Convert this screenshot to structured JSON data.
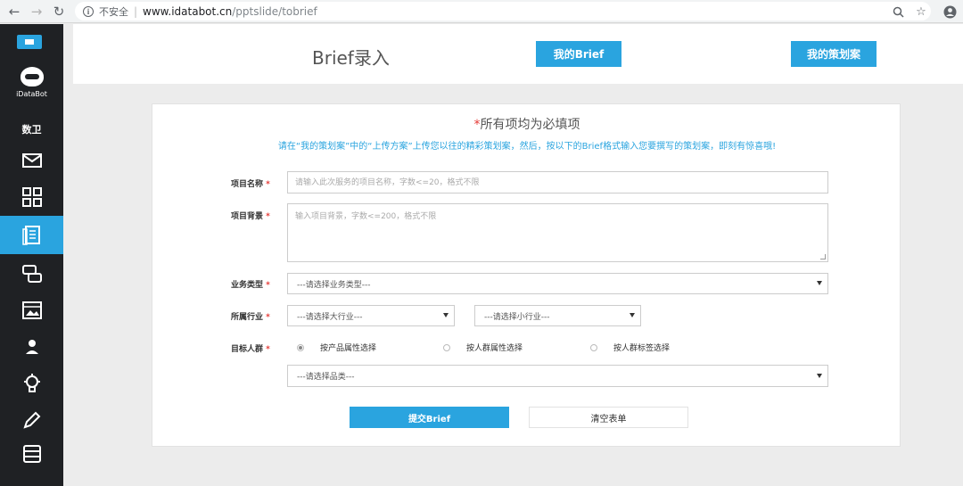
{
  "browser": {
    "back_icon": "arrow-left-icon",
    "forward_icon": "arrow-right-icon",
    "reload_icon": "reload-icon",
    "security_label": "不安全",
    "url_host": "www.idatabot.cn",
    "url_path": "/pptslide/tobrief",
    "zoom_icon": "magnifier-icon",
    "bookmark_icon": "star-icon",
    "account_icon": "account-icon"
  },
  "sidebar": {
    "brand": "iDataBot",
    "section_label": "数卫",
    "active_index": 2,
    "items": [
      {
        "icon": "mail-icon"
      },
      {
        "icon": "grid-icon"
      },
      {
        "icon": "document-icon"
      },
      {
        "icon": "chat-icon"
      },
      {
        "icon": "gallery-icon"
      },
      {
        "icon": "user-icon"
      },
      {
        "icon": "lightbulb-icon"
      },
      {
        "icon": "pen-icon"
      },
      {
        "icon": "list-icon"
      }
    ],
    "accent": "#2aa4df",
    "background": "#1f2124"
  },
  "header": {
    "title": "Brief录入",
    "my_brief_label": "我的Brief",
    "my_plans_label": "我的策划案"
  },
  "form": {
    "required_star": "*",
    "required_title": "所有项均为必填项",
    "hint": "请在“我的策划案”中的“上传方案”上传您以往的精彩策划案，然后，按以下的Brief格式输入您要撰写的策划案，即刻有惊喜哦!",
    "project_name": {
      "label": "项目名称",
      "star": "*",
      "placeholder": "请输入此次服务的项目名称，字数<=20，格式不限",
      "value": ""
    },
    "project_background": {
      "label": "项目背景",
      "star": "*",
      "placeholder": "输入项目背景，字数<=200，格式不限",
      "value": ""
    },
    "business_type": {
      "label": "业务类型",
      "star": "*",
      "selected": "---请选择业务类型---"
    },
    "industry": {
      "label": "所属行业",
      "star": "*",
      "major_selected": "---请选择大行业---",
      "minor_selected": "---请选择小行业---"
    },
    "audience": {
      "label": "目标人群",
      "star": "*",
      "options": [
        "按产品属性选择",
        "按人群属性选择",
        "按人群标签选择"
      ],
      "selected_index": 0,
      "category_selected": "---请选择品类---"
    },
    "submit_label": "提交Brief",
    "clear_label": "清空表单"
  }
}
